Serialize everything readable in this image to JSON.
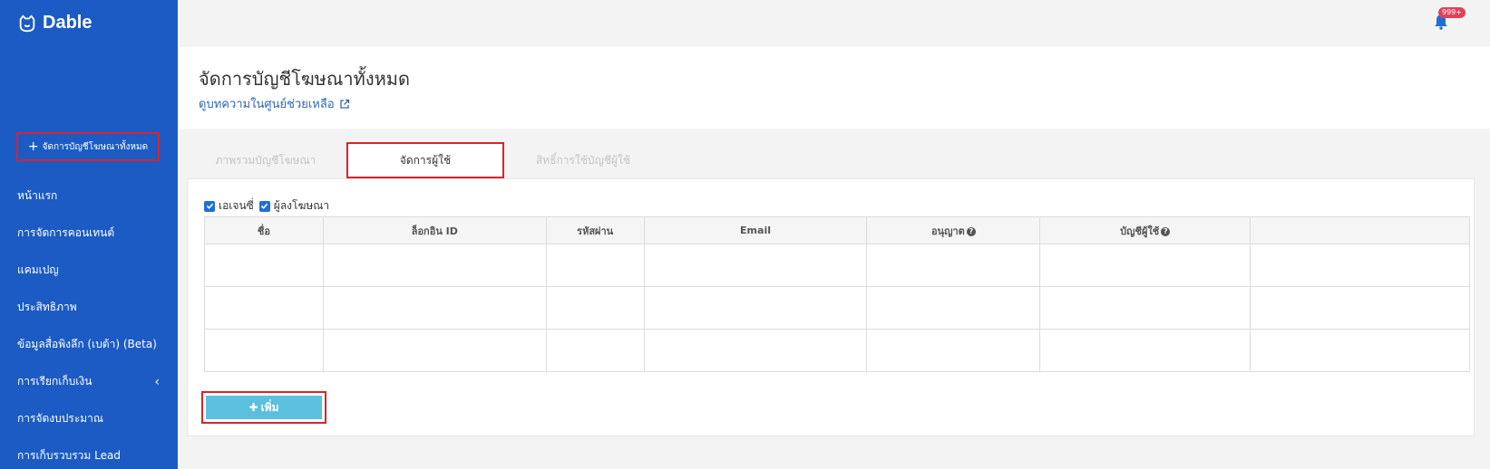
{
  "sidebar": {
    "logo": "Dable",
    "new_button": "จัดการบัญชีโฆษณาทั้งหมด",
    "items": [
      {
        "label": "หน้าแรก"
      },
      {
        "label": "การจัดการคอนเทนต์"
      },
      {
        "label": "แคมเปญ"
      },
      {
        "label": "ประสิทธิภาพ"
      },
      {
        "label": "ข้อมูลสื่อพิงลึก (เบต้า) (Beta)"
      },
      {
        "label": "การเรียกเก็บเงิน"
      },
      {
        "label": "การจัดงบประมาณ"
      },
      {
        "label": "การเก็บรวบรวม Lead"
      }
    ]
  },
  "topbar": {
    "notifications_badge": "999+"
  },
  "header": {
    "title": "จัดการบัญชีโฆษณาทั้งหมด",
    "help_link": "ดูบทความในศูนย์ช่วยเหลือ"
  },
  "tabs": [
    {
      "label": "ภาพรวมบัญชีโฆษณา"
    },
    {
      "label": "จัดการผู้ใช้"
    },
    {
      "label": "สิทธิ์การใช้บัญชีผู้ใช้"
    }
  ],
  "filters": [
    {
      "label": "เอเจนซี่",
      "checked": true
    },
    {
      "label": "ผู้ลงโฆษณา",
      "checked": true
    }
  ],
  "table": {
    "columns": [
      "ชื่อ",
      "ล็อกอิน ID",
      "รหัสผ่าน",
      "Email",
      "อนุญาต",
      "บัญชีผู้ใช้",
      ""
    ]
  },
  "add_button": "เพิ่ม",
  "colors": {
    "sidebar": "#1c5bc4",
    "highlight": "#d9232d",
    "add_button": "#5bc0de",
    "link": "#2f67b5"
  }
}
